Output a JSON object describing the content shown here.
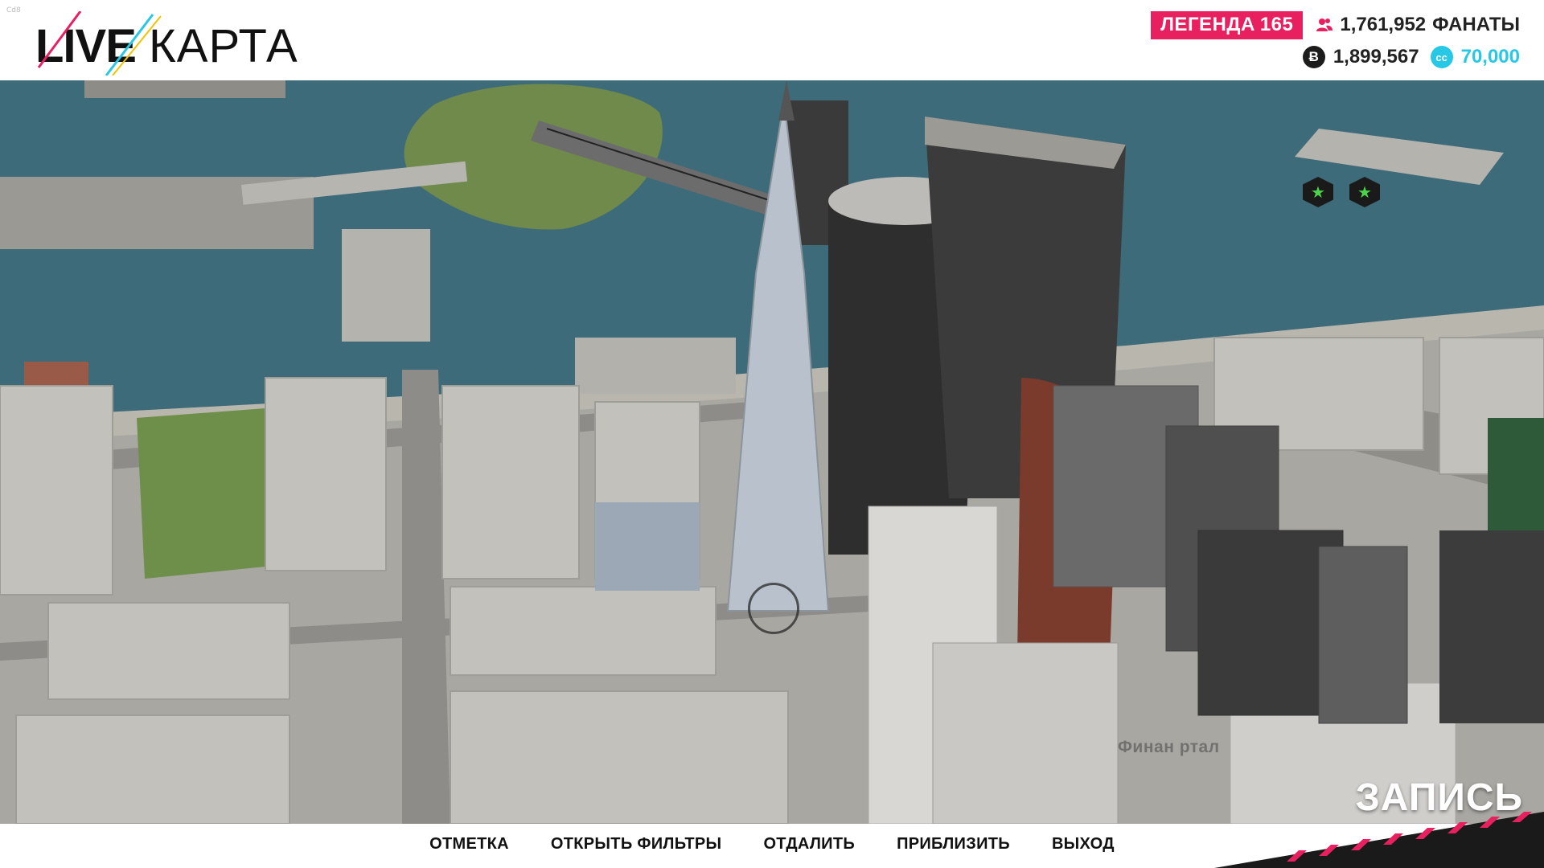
{
  "corner_tag": "Cd8",
  "logo": {
    "part1": "LIVE",
    "part2": "КАРТА"
  },
  "header": {
    "legend_label": "ЛЕГЕНДА",
    "legend_level": "165",
    "fans_count": "1,761,952",
    "fans_label": "ФАНАТЫ",
    "bucks_icon": "Ƀ",
    "bucks": "1,899,567",
    "cc_icon": "cc",
    "cc": "70,000"
  },
  "map": {
    "district_label": "Финан           ртал",
    "record_label": "ЗАПИСЬ"
  },
  "menu": {
    "items": [
      {
        "label": "ОТМЕТКА"
      },
      {
        "label": "ОТКРЫТЬ ФИЛЬТРЫ"
      },
      {
        "label": "ОТДАЛИТЬ"
      },
      {
        "label": "ПРИБЛИЗИТЬ"
      },
      {
        "label": "ВЫХОД"
      }
    ]
  },
  "colors": {
    "accent_pink": "#e9205f",
    "cc_cyan": "#27c7e6",
    "water": "#3d6b7a"
  }
}
